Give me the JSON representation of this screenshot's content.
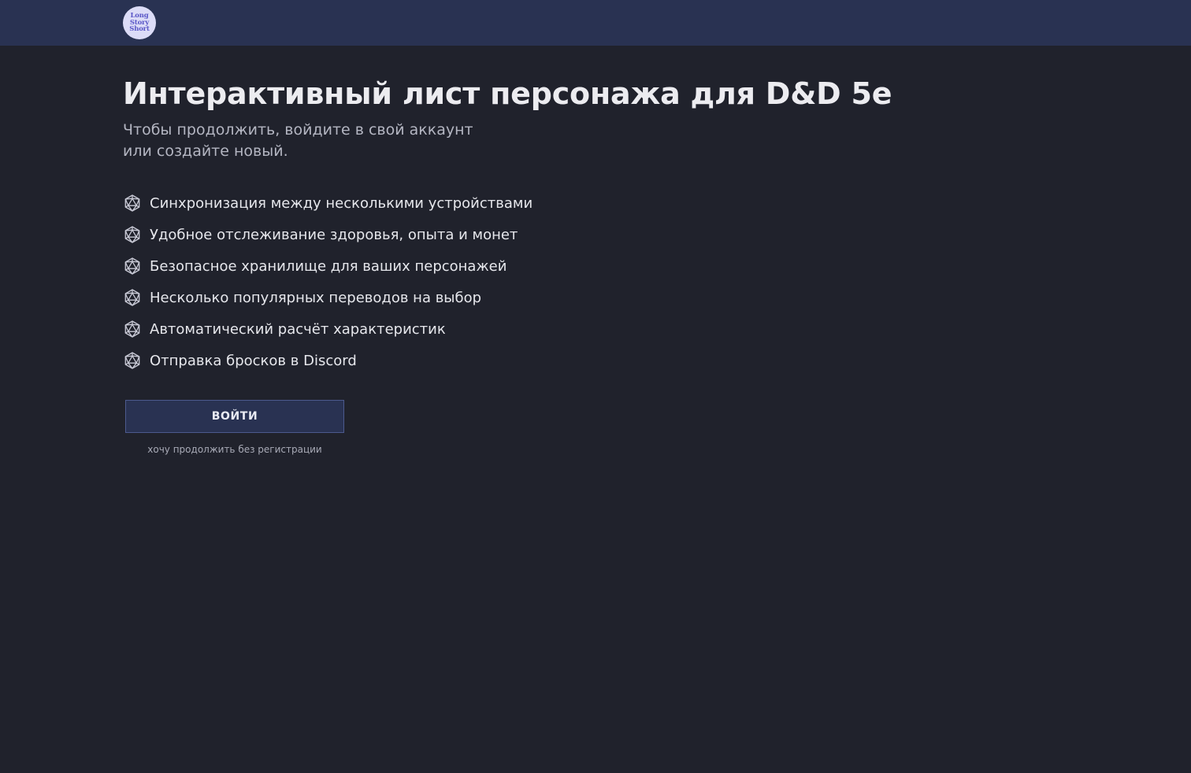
{
  "header": {
    "logo": {
      "lines": [
        "Long",
        "Story",
        "Short"
      ],
      "colors": {
        "background": "#dcdcf7",
        "text": "#5a57c7"
      }
    }
  },
  "main": {
    "title": "Интерактивный лист персонажа для D&D 5e",
    "subtitle": "Чтобы продолжить, войдите в свой аккаунт или создайте новый.",
    "features": [
      {
        "icon": "d20-icon",
        "label": "Синхронизация между несколькими устройствами"
      },
      {
        "icon": "d20-icon",
        "label": "Удобное отслеживание здоровья, опыта и монет"
      },
      {
        "icon": "d20-icon",
        "label": "Безопасное хранилище для ваших персонажей"
      },
      {
        "icon": "d20-icon",
        "label": "Несколько популярных переводов на выбор"
      },
      {
        "icon": "d20-icon",
        "label": "Автоматический расчёт характеристик"
      },
      {
        "icon": "d20-icon",
        "label": "Отправка бросков в Discord"
      }
    ],
    "login_button": "Войти",
    "guest_link": "хочу продолжить без регистрации"
  },
  "colors": {
    "background": "#20222c",
    "topbar": "#293252",
    "button": "#293252",
    "button_border": "#4c5a8e",
    "text_primary": "#ececf0",
    "text_secondary": "#b4b6c2"
  }
}
